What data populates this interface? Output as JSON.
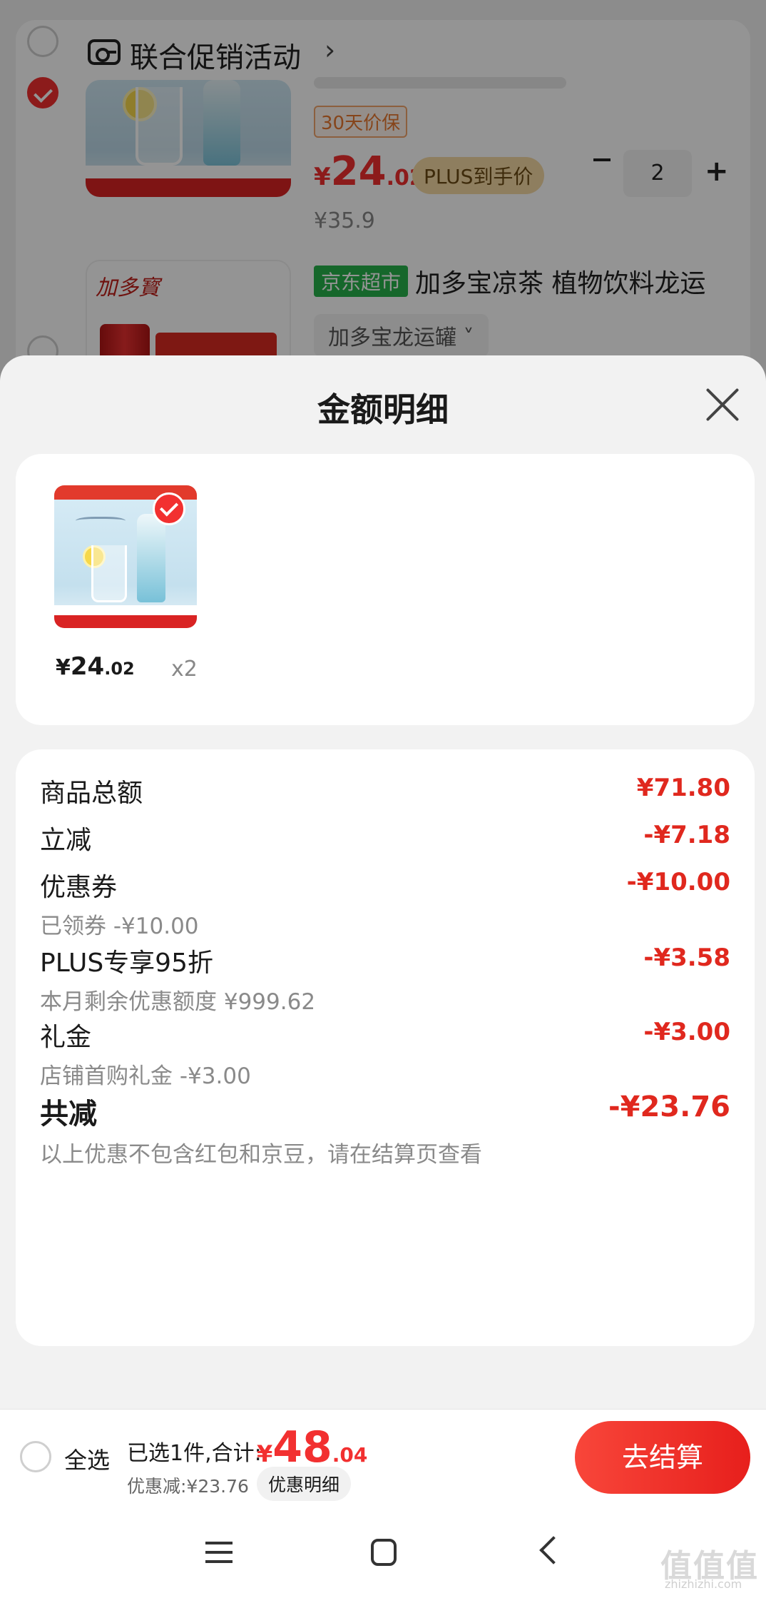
{
  "background_cart": {
    "promo_title": "联合促销活动",
    "promo_chevron": "›",
    "product1": {
      "guarantee_tag": "30天价保",
      "price_symbol": "¥",
      "price_int": "24",
      "price_dec": ".02",
      "plus_tag": "PLUS到手价",
      "quantity": "2",
      "original_price": "¥35.9"
    },
    "product2": {
      "brand_logo_text": "加多寳",
      "store_tag": "京东超市",
      "title": "加多宝凉茶 植物饮料龙运",
      "variant": "加多宝龙运罐 ˅"
    }
  },
  "sheet": {
    "title": "金额明细",
    "item": {
      "price_symbol": "¥",
      "price_int": "24",
      "price_dec": ".02",
      "quantity": "x2"
    },
    "rows": [
      {
        "label": "商品总额",
        "value": "¥71.80",
        "sub": ""
      },
      {
        "label": "立减",
        "value": "-¥7.18",
        "sub": ""
      },
      {
        "label": "优惠券",
        "value": "-¥10.00",
        "sub": "已领券 -¥10.00"
      },
      {
        "label": "PLUS专享95折",
        "value": "-¥3.58",
        "sub": "本月剩余优惠额度 ¥999.62"
      },
      {
        "label": "礼金",
        "value": "-¥3.00",
        "sub": "店铺首购礼金 -¥3.00"
      }
    ],
    "total": {
      "label": "共减",
      "value": "-¥23.76",
      "note": "以上优惠不包含红包和京豆，请在结算页查看"
    }
  },
  "bottom_bar": {
    "select_all": "全选",
    "summary_label": "已选1件,合计:",
    "total_symbol": "¥",
    "total_int": "48",
    "total_dec": ".04",
    "discount": "优惠减:¥23.76",
    "detail_chip": "优惠明细",
    "checkout": "去结算"
  },
  "watermark": {
    "logo": "值值值",
    "url": "zhizhizhi.com"
  },
  "colors": {
    "accent_red": "#f23030",
    "value_red": "#e0281e",
    "jd_green": "#26b24a",
    "plus_gold": "#f5d9a4"
  }
}
